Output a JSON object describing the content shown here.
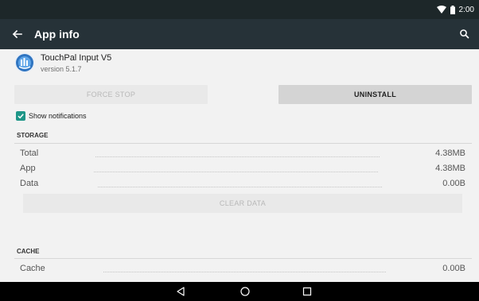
{
  "status_bar": {
    "time": "2:00"
  },
  "app_bar": {
    "title": "App info"
  },
  "app": {
    "name": "TouchPal Input V5",
    "version": "version 5.1.7"
  },
  "buttons": {
    "force_stop": "FORCE STOP",
    "uninstall": "UNINSTALL",
    "clear_data": "CLEAR DATA"
  },
  "notifications": {
    "label": "Show notifications",
    "checked": true
  },
  "storage": {
    "header": "STORAGE",
    "rows": [
      {
        "label": "Total",
        "value": "4.38MB"
      },
      {
        "label": "App",
        "value": "4.38MB"
      },
      {
        "label": "Data",
        "value": "0.00B"
      }
    ]
  },
  "cache": {
    "header": "CACHE",
    "rows": [
      {
        "label": "Cache",
        "value": "0.00B"
      }
    ]
  },
  "colors": {
    "status_bar": "#1d2729",
    "app_bar": "#263238",
    "accent": "#1e9688",
    "background": "#f2f2f2"
  },
  "icons": [
    "wifi-icon",
    "battery-icon",
    "back-arrow-icon",
    "search-icon",
    "touchpal-app-icon",
    "checkmark-icon",
    "nav-back-icon",
    "nav-home-icon",
    "nav-recents-icon"
  ]
}
